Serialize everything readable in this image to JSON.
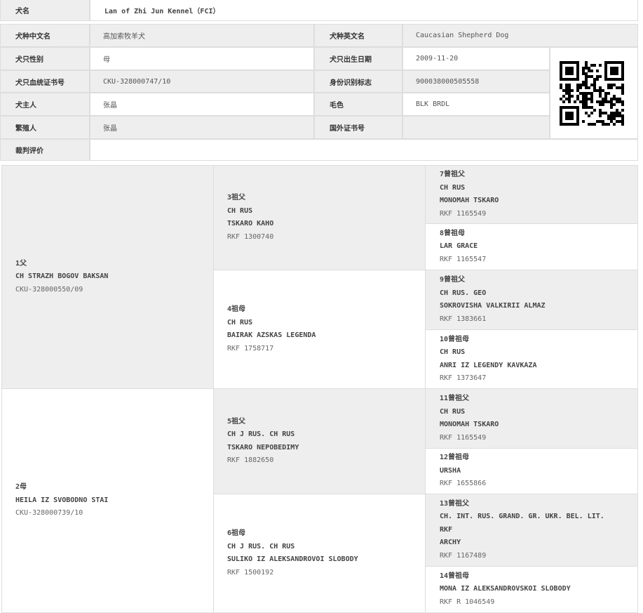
{
  "dog_info": {
    "name_label": "犬名",
    "name_value": "Lan of Zhi Jun Kennel（FCI）",
    "breed_cn_label": "犬种中文名",
    "breed_cn_value": "高加索牧羊犬",
    "breed_en_label": "犬种英文名",
    "breed_en_value": "Caucasian Shepherd Dog",
    "sex_label": "犬只性别",
    "sex_value": "母",
    "dob_label": "犬只出生日期",
    "dob_value": "2009-11-20",
    "pedigree_no_label": "犬只血统证书号",
    "pedigree_no_value": "CKU-328000747/10",
    "id_mark_label": "身份识别标志",
    "id_mark_value": "900038000505558",
    "owner_label": "犬主人",
    "owner_value": "张晶",
    "color_label": "毛色",
    "color_value": "BLK BRDL",
    "breeder_label": "繁殖人",
    "breeder_value": "张晶",
    "foreign_cert_label": "国外证书号",
    "foreign_cert_value": "",
    "judge_label": "裁判评价",
    "judge_value": "",
    "qr_icon": "qr-code-icon"
  },
  "pedigree": {
    "sire": {
      "relation": "1父",
      "title": "",
      "name": "CH STRAZH BOGOV BAKSAN",
      "reg": "CKU-328000550/09"
    },
    "dam": {
      "relation": "2母",
      "title": "",
      "name": "HEILA IZ SVOBODNO STAI",
      "reg": "CKU-328000739/10"
    },
    "gp3": {
      "relation": "3祖父",
      "title": "CH RUS",
      "name": "TSKARO KAHO",
      "reg": "RKF 1300740"
    },
    "gp4": {
      "relation": "4祖母",
      "title": "CH RUS",
      "name": "BAIRAK AZSKAS LEGENDA",
      "reg": "RKF 1758717"
    },
    "gp5": {
      "relation": "5祖父",
      "title": "CH J RUS. CH RUS",
      "name": "TSKARO NEPOBEDIMY",
      "reg": "RKF 1882650"
    },
    "gp6": {
      "relation": "6祖母",
      "title": "CH J RUS. CH RUS",
      "name": "SULIKO IZ ALEKSANDROVOI SLOBODY",
      "reg": "RKF 1500192"
    },
    "ggp7": {
      "relation": "7曾祖父",
      "title": "CH RUS",
      "name": "MONOMAH TSKARO",
      "reg": "RKF 1165549"
    },
    "ggp8": {
      "relation": "8曾祖母",
      "title": "",
      "name": "LAR GRACE",
      "reg": "RKF 1165547"
    },
    "ggp9": {
      "relation": "9曾祖父",
      "title": "CH RUS. GEO",
      "name": "SOKROVISHA VALKIRII ALMAZ",
      "reg": "RKF 1383661"
    },
    "ggp10": {
      "relation": "10曾祖母",
      "title": "CH RUS",
      "name": "ANRI IZ LEGENDY KAVKAZA",
      "reg": "RKF 1373647"
    },
    "ggp11": {
      "relation": "11曾祖父",
      "title": "CH RUS",
      "name": "MONOMAH TSKARO",
      "reg": "RKF 1165549"
    },
    "ggp12": {
      "relation": "12曾祖母",
      "title": "",
      "name": "URSHA",
      "reg": "RKF 1655866"
    },
    "ggp13": {
      "relation": "13曾祖父",
      "title": "CH. INT. RUS. GRAND. GR. UKR. BEL. LIT.",
      "title2": "RKF",
      "name": "ARCHY",
      "reg": "RKF 1167489"
    },
    "ggp14": {
      "relation": "14曾祖母",
      "title": "",
      "name": "MONA IZ ALEKSANDROVSKOI SLOBODY",
      "reg": "RKF R 1046549"
    }
  }
}
